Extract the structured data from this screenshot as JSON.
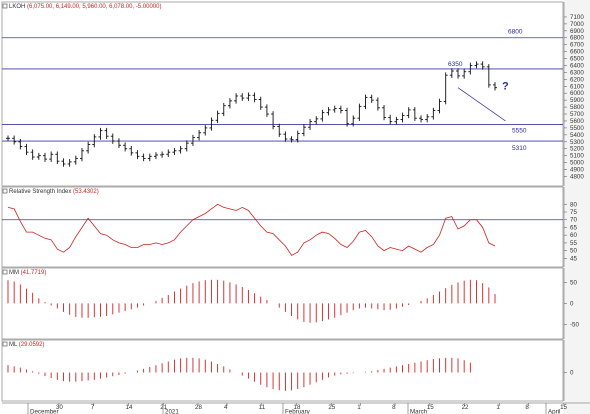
{
  "chart_data": [
    {
      "type": "ohlc",
      "title": "LKOH",
      "ohlc_label": "(6,075.00, 6,149.00, 5,960.00, 6,078.00, -5.00000)",
      "yticks": [
        4800,
        4900,
        5000,
        5100,
        5200,
        5300,
        5400,
        5500,
        5600,
        5700,
        5800,
        5900,
        6000,
        6100,
        6200,
        6300,
        6400,
        6500,
        6600,
        6700,
        6800,
        6900,
        7000,
        7100
      ],
      "ylim": [
        4720,
        7200
      ],
      "hlines": [
        6800,
        6350,
        5550,
        5310
      ],
      "annotations": [
        {
          "text": "6800",
          "x": "6800"
        },
        {
          "text": "6350",
          "x": "6350"
        },
        {
          "text": "5550",
          "x": "5550"
        },
        {
          "text": "5310",
          "x": "5310"
        },
        {
          "text": "?",
          "x": "question"
        }
      ],
      "trend_line": [
        {
          "bar": 73,
          "value": 6080
        },
        {
          "bar": 80,
          "value": 5600
        }
      ],
      "bars_close": [
        5350,
        5300,
        5230,
        5150,
        5080,
        5100,
        5050,
        5120,
        5020,
        4980,
        5010,
        5060,
        5170,
        5260,
        5370,
        5460,
        5380,
        5310,
        5250,
        5200,
        5140,
        5090,
        5060,
        5090,
        5110,
        5120,
        5150,
        5170,
        5200,
        5280,
        5360,
        5430,
        5500,
        5610,
        5710,
        5820,
        5890,
        5960,
        5930,
        5970,
        5910,
        5800,
        5700,
        5520,
        5410,
        5340,
        5330,
        5420,
        5510,
        5590,
        5630,
        5720,
        5760,
        5780,
        5750,
        5560,
        5640,
        5810,
        5940,
        5900,
        5790,
        5650,
        5590,
        5620,
        5680,
        5760,
        5640,
        5620,
        5660,
        5750,
        5880,
        6260,
        6320,
        6250,
        6310,
        6400,
        6420,
        6380,
        6120,
        6080
      ],
      "xlabels": [
        "30",
        "7",
        "14",
        "21",
        "28",
        "4",
        "11",
        "18",
        "25",
        "1",
        "8",
        "15",
        "22",
        "1",
        "8",
        "15",
        "22",
        "29",
        "5"
      ],
      "month_labels": [
        "December",
        "2021",
        "February",
        "March",
        "April"
      ]
    },
    {
      "type": "line",
      "title": "Relative Strength Index",
      "value_label": "(53.4302)",
      "yticks": [
        45,
        50,
        55,
        60,
        65,
        70,
        75,
        80
      ],
      "ylim": [
        42,
        86
      ],
      "hlines": [
        70,
        30
      ],
      "values": [
        78,
        77,
        69,
        62,
        62,
        60,
        58,
        57,
        51,
        49,
        52,
        59,
        65,
        71,
        66,
        61,
        60,
        57,
        55,
        54,
        52,
        52,
        54,
        54,
        55,
        54,
        55,
        57,
        62,
        66,
        70,
        72,
        74,
        77,
        80,
        78,
        77,
        76,
        78,
        76,
        71,
        66,
        62,
        61,
        57,
        53,
        47,
        49,
        55,
        57,
        60,
        62,
        61,
        58,
        54,
        52,
        56,
        62,
        63,
        59,
        53,
        50,
        52,
        51,
        50,
        53,
        51,
        49,
        52,
        54,
        60,
        71,
        72,
        64,
        66,
        70,
        70,
        65,
        55,
        53
      ]
    },
    {
      "type": "bar",
      "title": "MM",
      "value_label": "(41.7719)",
      "yticks": [
        50,
        0,
        -50
      ],
      "ylim": [
        -75,
        65
      ],
      "values": [
        55,
        52,
        45,
        35,
        25,
        12,
        3,
        -5,
        -12,
        -20,
        -27,
        -32,
        -34,
        -34,
        -33,
        -32,
        -30,
        -26,
        -22,
        -18,
        -14,
        -10,
        -5,
        0,
        6,
        13,
        20,
        28,
        35,
        42,
        48,
        52,
        55,
        56,
        56,
        54,
        50,
        45,
        39,
        32,
        24,
        16,
        8,
        0,
        -10,
        -20,
        -30,
        -38,
        -44,
        -46,
        -45,
        -42,
        -38,
        -34,
        -28,
        -22,
        -16,
        -12,
        -10,
        -12,
        -14,
        -16,
        -15,
        -12,
        -8,
        -4,
        0,
        6,
        12,
        20,
        28,
        36,
        44,
        50,
        54,
        56,
        55,
        48,
        38,
        22
      ]
    },
    {
      "type": "bar",
      "title": "ML",
      "value_label": "(29.0592)",
      "yticks": [
        0
      ],
      "ylim": [
        -40,
        40
      ],
      "values": [
        12,
        10,
        8,
        5,
        2,
        -2,
        -6,
        -9,
        -12,
        -14,
        -15,
        -15,
        -14,
        -13,
        -12,
        -10,
        -8,
        -6,
        -4,
        -2,
        0,
        3,
        6,
        9,
        12,
        15,
        18,
        21,
        23,
        24,
        24,
        23,
        21,
        18,
        14,
        10,
        5,
        0,
        -5,
        -10,
        -15,
        -20,
        -24,
        -27,
        -29,
        -30,
        -29,
        -27,
        -24,
        -20,
        -16,
        -12,
        -8,
        -5,
        -3,
        -2,
        -1,
        0,
        1,
        2,
        4,
        6,
        8,
        10,
        12,
        14,
        16,
        18,
        20,
        22,
        23,
        24,
        24,
        23,
        20,
        16
      ]
    }
  ]
}
